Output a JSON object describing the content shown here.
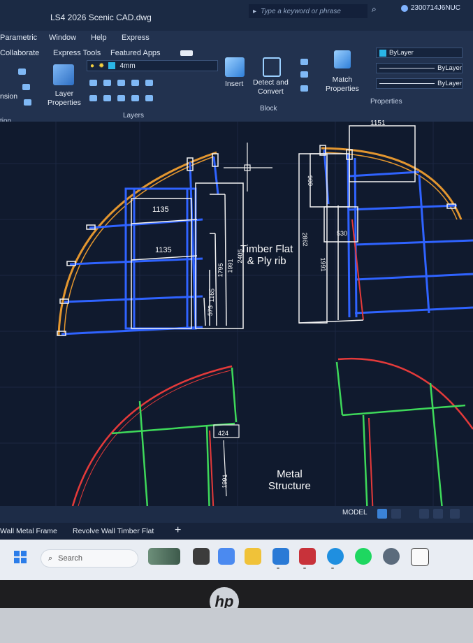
{
  "window": {
    "title": "LS4 2026 Scenic CAD.dwg",
    "search_placeholder": "Type a keyword or phrase",
    "user": "2300714J6NUC"
  },
  "menu": {
    "items": [
      "Parametric",
      "Window",
      "Help",
      "Express"
    ]
  },
  "ribbon_tabs": [
    "Collaborate",
    "Express Tools",
    "Featured Apps"
  ],
  "ribbon": {
    "dimension_label": "nsion",
    "layer_properties_label": "Layer\nProperties",
    "layer_current": "4mm",
    "layers_panel": "Layers",
    "insert_label": "Insert",
    "detect_convert_label": "Detect and\nConvert",
    "block_panel": "Block",
    "match_properties_label": "Match\nProperties",
    "bylayer_color": "ByLayer",
    "bylayer_linetype": "ByLayer",
    "bylayer_lineweight": "ByLayer",
    "properties_panel": "Properties",
    "annotation_panel": "tion"
  },
  "drawing": {
    "dims_left": [
      "1135",
      "1135",
      "575",
      "1165",
      "1795",
      "1991",
      "2405"
    ],
    "dims_right": [
      "1151",
      "900",
      "2862",
      "530",
      "1991"
    ],
    "dims_bottom": [
      "424",
      "1991"
    ],
    "label_timber": "Timber Flat\n& Ply rib",
    "label_metal": "Metal\nStructure"
  },
  "status": {
    "model": "MODEL"
  },
  "layout_tabs": [
    "Wall Metal Frame",
    "Revolve Wall Timber Flat",
    "+"
  ],
  "taskbar": {
    "search": "Search"
  },
  "brand": "hp",
  "colors": {
    "arc_orange": "#e3962f",
    "frame_blue": "#2f63ff",
    "white_line": "#f2f2f2",
    "red_line": "#e43a3a",
    "green_line": "#3ed85a"
  }
}
